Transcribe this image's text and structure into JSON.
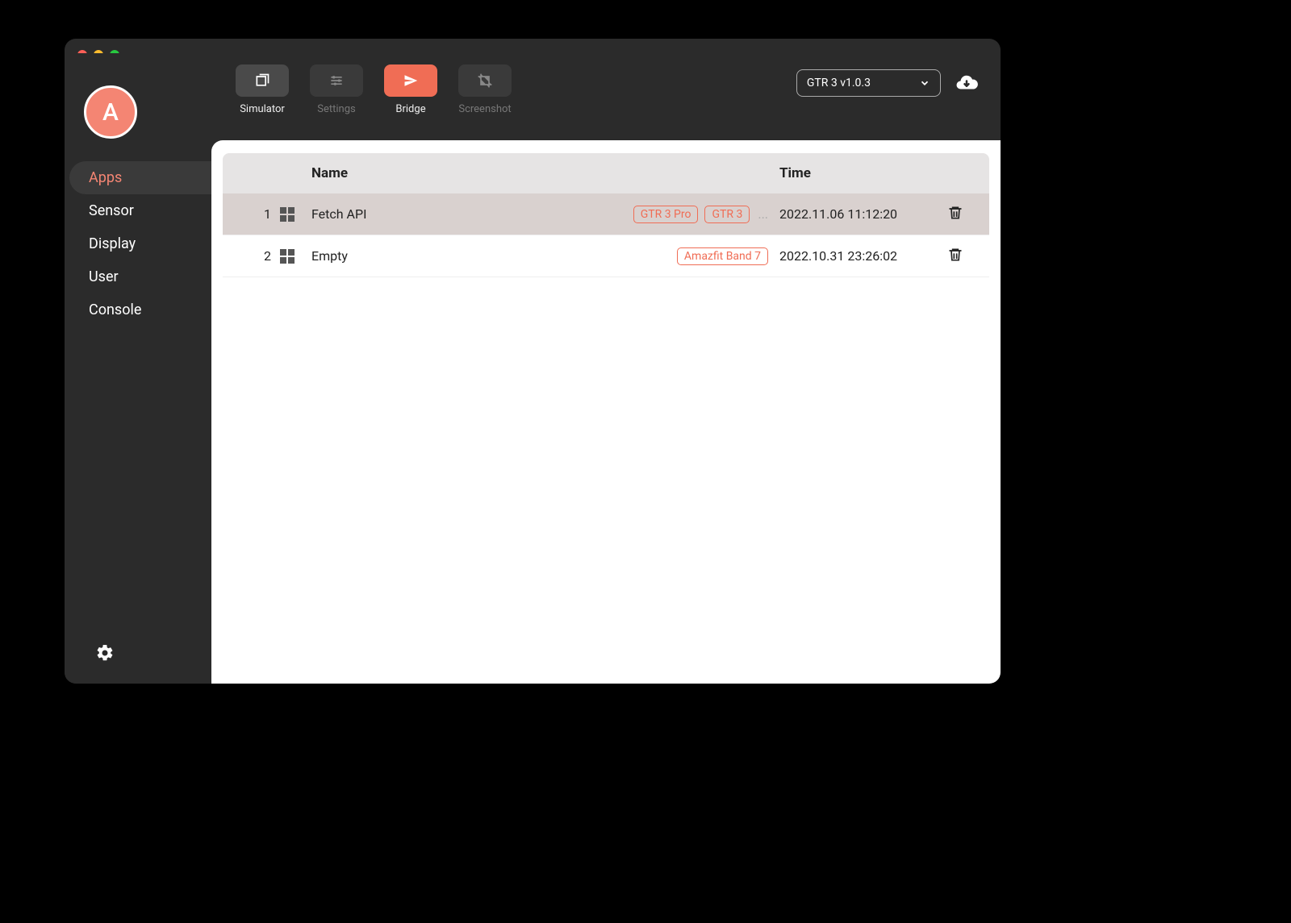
{
  "avatar_letter": "A",
  "sidebar": {
    "items": [
      {
        "label": "Apps",
        "active": true
      },
      {
        "label": "Sensor",
        "active": false
      },
      {
        "label": "Display",
        "active": false
      },
      {
        "label": "User",
        "active": false
      },
      {
        "label": "Console",
        "active": false
      }
    ]
  },
  "toolbar": {
    "simulator_label": "Simulator",
    "settings_label": "Settings",
    "bridge_label": "Bridge",
    "screenshot_label": "Screenshot",
    "device_selected": "GTR 3 v1.0.3"
  },
  "table": {
    "header_name": "Name",
    "header_time": "Time",
    "rows": [
      {
        "index": "1",
        "name": "Fetch API",
        "tags": [
          "GTR 3 Pro",
          "GTR 3"
        ],
        "more": "...",
        "time": "2022.11.06 11:12:20",
        "selected": true
      },
      {
        "index": "2",
        "name": "Empty",
        "tags": [
          "Amazfit Band 7"
        ],
        "more": "",
        "time": "2022.10.31 23:26:02",
        "selected": false
      }
    ]
  }
}
